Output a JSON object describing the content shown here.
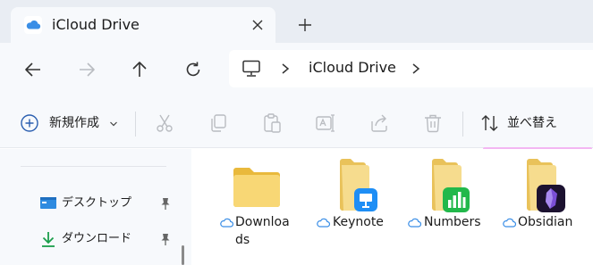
{
  "window": {
    "tab_title": "iCloud Drive",
    "tab_icon": "icloud-icon",
    "close_icon": "close-icon",
    "new_tab_icon": "plus-icon"
  },
  "navigation": {
    "back_icon": "arrow-left-icon",
    "forward_icon": "arrow-right-icon",
    "up_icon": "arrow-up-icon",
    "refresh_icon": "refresh-icon",
    "breadcrumb": {
      "root_icon": "this-pc-icon",
      "items": [
        "iCloud Drive"
      ]
    }
  },
  "command_bar": {
    "new_label": "新規作成",
    "tools": [
      "cut-icon",
      "copy-icon",
      "paste-icon",
      "rename-icon",
      "share-icon",
      "delete-icon"
    ],
    "sort_label": "並べ替え"
  },
  "sidebar": {
    "items": [
      {
        "label": "デスクトップ",
        "icon": "desktop-icon",
        "pinned": true
      },
      {
        "label": "ダウンロード",
        "icon": "download-icon",
        "pinned": true
      }
    ]
  },
  "content": {
    "files": [
      {
        "name": "Downloads",
        "name_line1": "Downloa",
        "name_line2": "ds",
        "type": "folder",
        "badge": null,
        "cloud": true,
        "selected": false
      },
      {
        "name": "Keynote",
        "type": "folder",
        "badge": "keynote-icon",
        "cloud": true,
        "selected": false
      },
      {
        "name": "Numbers",
        "type": "folder",
        "badge": "numbers-icon",
        "cloud": true,
        "selected": false
      },
      {
        "name": "Obsidian",
        "type": "folder",
        "badge": "obsidian-icon",
        "cloud": true,
        "selected": true
      }
    ]
  },
  "colors": {
    "chrome_bg": "#f7f9fc",
    "tabbar_bg": "#e9edf3",
    "icloud_blue": "#3a8ee6",
    "folder_yellow": "#f4d57c",
    "selection_border": "#f3b6f2",
    "keynote_blue": "#1e8ef5",
    "numbers_green": "#22b84b",
    "obsidian_purple": "#7b4fd6"
  }
}
